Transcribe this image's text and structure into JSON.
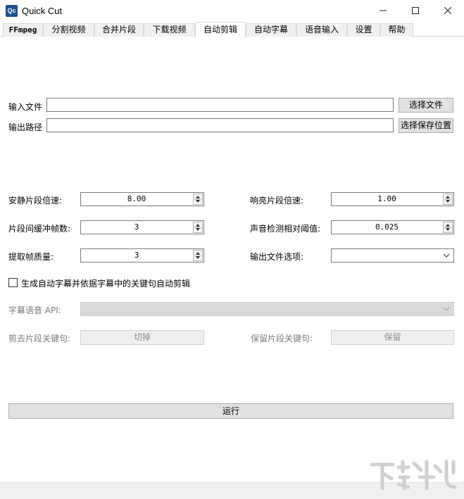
{
  "window": {
    "icon_text": "Qc",
    "title": "Quick Cut",
    "minimize_icon": "minimize-icon",
    "maximize_icon": "maximize-icon",
    "close_icon": "close-icon"
  },
  "tabs": [
    {
      "label": "FFmpeg"
    },
    {
      "label": "分割视频"
    },
    {
      "label": "合并片段"
    },
    {
      "label": "下载视频"
    },
    {
      "label": "自动剪辑",
      "active": true
    },
    {
      "label": "自动字幕"
    },
    {
      "label": "语音输入"
    },
    {
      "label": "设置"
    },
    {
      "label": "帮助"
    }
  ],
  "files": {
    "input_label": "输入文件",
    "input_value": "",
    "choose_file_button": "选择文件",
    "output_label": "输出路径",
    "output_value": "",
    "choose_save_button": "选择保存位置"
  },
  "params": {
    "silent_speed_label": "安静片段倍速:",
    "silent_speed_value": "8.00",
    "sounded_speed_label": "响亮片段倍速:",
    "sounded_speed_value": "1.00",
    "frame_margin_label": "片段间缓冲帧数:",
    "frame_margin_value": "3",
    "threshold_label": "声音检测相对阈值:",
    "threshold_value": "0.025",
    "frame_quality_label": "提取帧质量:",
    "frame_quality_value": "3",
    "output_option_label": "输出文件选项:",
    "output_option_value": ""
  },
  "subtitle": {
    "checkbox_label": "生成自动字幕并依据字幕中的关键句自动剪辑",
    "checked": false,
    "api_label": "字幕语音 API:",
    "api_value": "",
    "cut_keyword_label": "剪去片段关键句:",
    "cut_keyword_value": "切掉",
    "keep_keyword_label": "保留片段关键句:",
    "keep_keyword_value": "保留"
  },
  "run_button": "运行",
  "watermark": "下载吧"
}
